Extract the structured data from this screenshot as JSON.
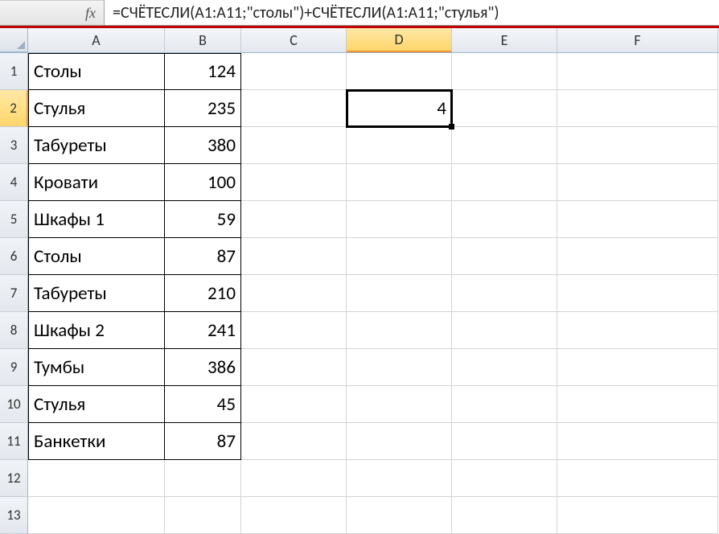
{
  "formula_bar": {
    "fx_label": "fx",
    "formula": "=СЧЁТЕСЛИ(A1:A11;\"столы\")+СЧЁТЕСЛИ(A1:A11;\"стулья\")"
  },
  "columns": [
    "A",
    "B",
    "C",
    "D",
    "E",
    "F"
  ],
  "active_column": "D",
  "active_row": 2,
  "selected_cell": "D2",
  "selected_value": "4",
  "rows": [
    {
      "n": 1,
      "a": "Столы",
      "b": "124"
    },
    {
      "n": 2,
      "a": "Стулья",
      "b": "235"
    },
    {
      "n": 3,
      "a": "Табуреты",
      "b": "380"
    },
    {
      "n": 4,
      "a": "Кровати",
      "b": "100"
    },
    {
      "n": 5,
      "a": "Шкафы 1",
      "b": "59"
    },
    {
      "n": 6,
      "a": "Столы",
      "b": "87"
    },
    {
      "n": 7,
      "a": "Табуреты",
      "b": "210"
    },
    {
      "n": 8,
      "a": "Шкафы 2",
      "b": "241"
    },
    {
      "n": 9,
      "a": "Тумбы",
      "b": "386"
    },
    {
      "n": 10,
      "a": "Стулья",
      "b": "45"
    },
    {
      "n": 11,
      "a": "Банкетки",
      "b": "87"
    }
  ],
  "extra_rows": [
    12,
    13
  ]
}
